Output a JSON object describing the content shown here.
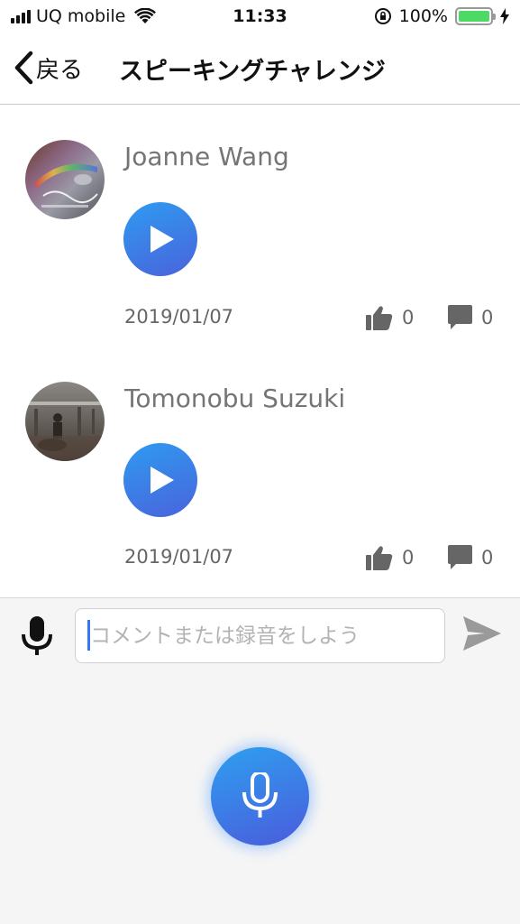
{
  "status_bar": {
    "carrier": "UQ mobile",
    "time": "11:33",
    "battery_percent": "100%",
    "battery_level": 1.0,
    "battery_color": "#4cd964"
  },
  "nav": {
    "back_label": "戻る",
    "title": "スピーキングチャレンジ"
  },
  "posts": [
    {
      "name": "Joanne Wang",
      "date": "2019/01/07",
      "likes": "0",
      "comments": "0"
    },
    {
      "name": "Tomonobu Suzuki",
      "date": "2019/01/07",
      "likes": "0",
      "comments": "0"
    }
  ],
  "composer": {
    "placeholder": "コメントまたは録音をしよう",
    "value": ""
  },
  "icons": {
    "back": "chevron-left-icon",
    "play": "play-icon",
    "like": "thumbs-up-icon",
    "comment": "comment-icon",
    "microphone": "microphone-icon",
    "send": "send-icon",
    "wifi": "wifi-icon",
    "orientation_lock": "rotation-lock-icon",
    "charging": "charging-bolt-icon"
  },
  "colors": {
    "accent_gradient_start": "#2e9bf0",
    "accent_gradient_end": "#4a63dc",
    "secondary_text": "#757575",
    "panel_background": "#f5f5f5"
  }
}
